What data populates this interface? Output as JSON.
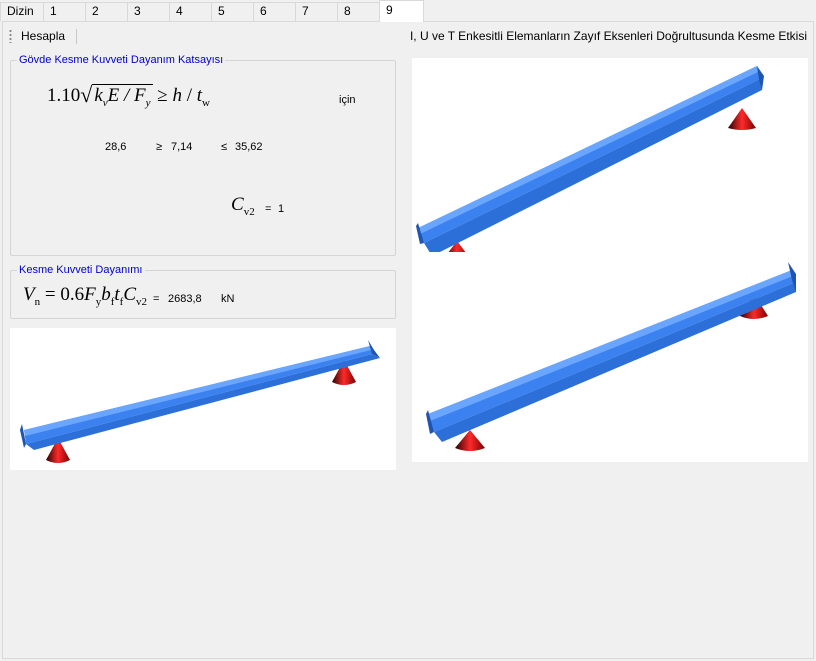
{
  "tabs": [
    {
      "label": "Dizin",
      "active": false
    },
    {
      "label": "1",
      "active": false
    },
    {
      "label": "2",
      "active": false
    },
    {
      "label": "3",
      "active": false
    },
    {
      "label": "4",
      "active": false
    },
    {
      "label": "5",
      "active": false
    },
    {
      "label": "6",
      "active": false
    },
    {
      "label": "7",
      "active": false
    },
    {
      "label": "8",
      "active": false
    },
    {
      "label": "9",
      "active": true
    }
  ],
  "toolbar": {
    "calculate_label": "Hesapla",
    "title": "I, U ve T Enkesitli Elemanların Zayıf Eksenleri Doğrultusunda Kesme Etkisi"
  },
  "web_coefficient": {
    "title": "Gövde Kesme Kuvveti Dayanım Katsayısı",
    "condition_label": "için",
    "lhs_value": "28,6",
    "geq_symbol": "≥",
    "ratio_value": "7,14",
    "leq_symbol": "≤",
    "limit_value": "35,62",
    "cv2_equals": "=",
    "cv2_value": "1"
  },
  "shear_strength": {
    "title": "Kesme Kuvveti Dayanımı",
    "equals": "=",
    "value": "2683,8",
    "unit": "kN"
  },
  "colors": {
    "accent_title": "#0000cc",
    "beam_blue": "#3b82f0",
    "support_red": "#e01010"
  }
}
